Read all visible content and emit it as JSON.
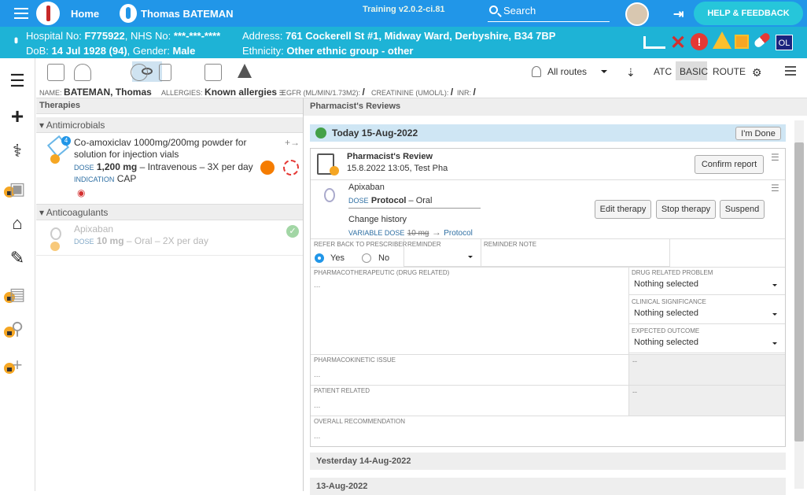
{
  "header": {
    "home": "Home",
    "patient": "Thomas BATEMAN",
    "training": "Training v2.0.2-ci.81",
    "search": "Search",
    "help": "HELP & FEEDBACK"
  },
  "banner": {
    "hosp_label": "Hospital No:",
    "hosp": "F775922",
    "nhs_label": ", NHS No:",
    "nhs": "***-***-****",
    "dob_label": "DoB:",
    "dob": "14 Jul 1928 (94)",
    "gender_label": ", Gender:",
    "gender": "Male",
    "addr_label": "Address:",
    "addr": "761 Cockerell St #1, Midway Ward, Derbyshire, B34 7BP",
    "eth_label": "Ethnicity:",
    "eth": "Other ethnic group - other",
    "ol": "OL"
  },
  "toolbar": {
    "routes": "All routes",
    "atc": "ATC",
    "basic": "BASIC",
    "route": "ROUTE"
  },
  "strip": {
    "name_l": "NAME:",
    "name": "BATEMAN, Thomas",
    "all_l": "ALLERGIES:",
    "all": "Known allergies",
    "egfr": "EGFR (ML/MIN/1.73M2):",
    "egfr_v": "/",
    "creat": "CREATININE (UMOL/L):",
    "creat_v": "/",
    "inr": "INR:",
    "inr_v": "/"
  },
  "left": {
    "title": "Therapies",
    "g1": "Antimicrobials",
    "d1a": "Co-amoxiclav 1000mg/200mg powder for",
    "d1b": "solution for injection vials",
    "d1_dose_l": "DOSE",
    "d1_dose": "1,200 mg",
    "d1_rest": " – Intravenous – 3X per day",
    "d1_ind_l": "INDICATION",
    "d1_ind": "CAP",
    "badge": "4",
    "g2": "Anticoagulants",
    "d2": "Apixaban",
    "d2_dose_l": "DOSE",
    "d2_dose": "10 mg",
    "d2_rest": " – Oral – 2X per day"
  },
  "right": {
    "title": "Pharmacist's Reviews",
    "today": "Today 15-Aug-2022",
    "done": "I'm Done",
    "rev_title": "Pharmacist's Review",
    "rev_sub": "15.8.2022 13:05, Test Pha",
    "confirm": "Confirm report",
    "drug": "Apixaban",
    "dose_l": "DOSE",
    "dose": "Protocol",
    "dose_r": " – Oral",
    "ch": "Change history",
    "var_l": "VARIABLE DOSE",
    "var_old": "10 mg",
    "var_new": "Protocol",
    "edit": "Edit therapy",
    "stop": "Stop therapy",
    "susp": "Suspend",
    "refer": "REFER BACK TO PRESCRIBER",
    "yes": "Yes",
    "no": "No",
    "reminder": "REMINDER",
    "rnote": "REMINDER NOTE",
    "pharmaco": "PHARMACOTHERAPEUTIC (DRUG RELATED)",
    "dots": "...",
    "drp": "DRUG RELATED PROBLEM",
    "ns": "Nothing selected",
    "clin": "CLINICAL SIGNIFICANCE",
    "exp": "EXPECTED OUTCOME",
    "pk": "PHARMACOKINETIC ISSUE",
    "dash": "--",
    "pr": "PATIENT RELATED",
    "overall": "OVERALL RECOMMENDATION",
    "yesterday": "Yesterday 14-Aug-2022",
    "d13": "13-Aug-2022"
  }
}
